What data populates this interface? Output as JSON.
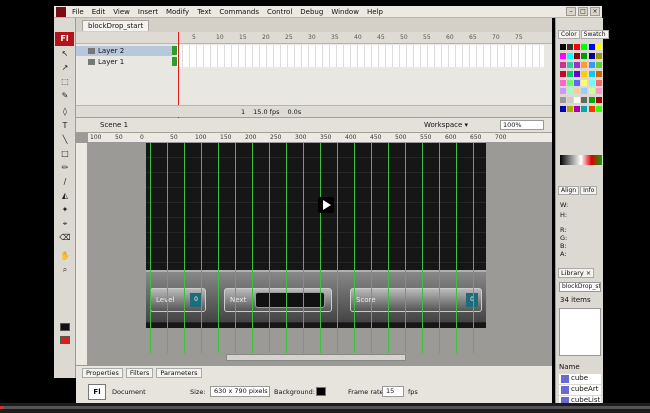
{
  "menu": {
    "app_icon": "flash-icon",
    "items": [
      "File",
      "Edit",
      "View",
      "Insert",
      "Modify",
      "Text",
      "Commands",
      "Control",
      "Debug",
      "Window",
      "Help"
    ]
  },
  "toolbar": {
    "badge": "Fl",
    "tools": [
      "↖",
      "↗",
      "⬚",
      "✎",
      "◊",
      "T",
      "╲",
      "□",
      "✏",
      "∕",
      "◭",
      "✦",
      "⌖",
      "⌫",
      "✋",
      "⌕"
    ]
  },
  "document": {
    "tab": "blockDrop_start"
  },
  "timeline": {
    "frame_numbers": [
      "1",
      "5",
      "10",
      "15",
      "20",
      "25",
      "30",
      "35",
      "40",
      "45",
      "50",
      "55",
      "60",
      "65",
      "70",
      "75"
    ],
    "layers": [
      "Layer 2",
      "Layer 1"
    ],
    "footer": {
      "frame": "1",
      "fps": "15.0 fps",
      "time": "0.0s"
    }
  },
  "edit_bar": {
    "scene": "Scene 1",
    "workspace": "Workspace ▾",
    "zoom": "100%"
  },
  "ruler": [
    "100",
    "50",
    "0",
    "50",
    "100",
    "150",
    "200",
    "250",
    "300",
    "350",
    "400",
    "450",
    "500",
    "550",
    "600",
    "650",
    "700"
  ],
  "stage": {
    "hud_labels": {
      "level": "Level",
      "next": "Next",
      "score": "Score"
    },
    "hud_values": {
      "level": "0",
      "score": "0"
    }
  },
  "properties": {
    "tabs": [
      "Properties",
      "Filters",
      "Parameters"
    ],
    "doc_icon": "Fl",
    "doc_label": "Document",
    "size_label": "Size:",
    "size_value": "630 x 790 pixels",
    "background_label": "Background:",
    "background_color": "#000000",
    "frame_rate_label": "Frame rate:",
    "frame_rate_value": "15",
    "fps_label": "fps"
  },
  "right_panel": {
    "color_tabs": [
      "Color",
      "Swatch"
    ],
    "align_tabs": [
      "Align",
      "Info"
    ],
    "info_lines": [
      "W:",
      "H:",
      "R:",
      "G:",
      "B:",
      "A:"
    ],
    "library_tab": "Library ×",
    "library_doc": "blockDrop_start",
    "library_count": "34 items",
    "library_header": "Name",
    "library_items": [
      "cube",
      "cubeArt",
      "cubeList"
    ]
  },
  "colors": {
    "accent": "#b2141c",
    "guides": "#3fbf3f",
    "playhead": "#e01a1a"
  }
}
